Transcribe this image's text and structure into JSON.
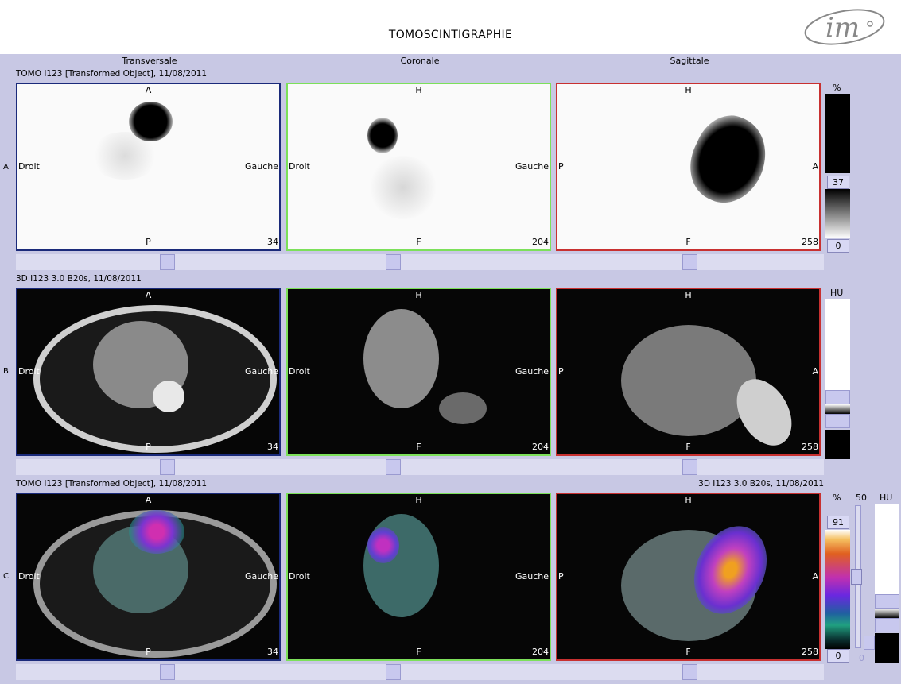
{
  "title": "TOMOSCINTIGRAPHIE",
  "logo_text": "im",
  "columns": [
    "Transversale",
    "Coronale",
    "Sagittale"
  ],
  "rows": [
    {
      "letter": "A",
      "caption": "TOMO I123 [Transformed Object], 11/08/2011"
    },
    {
      "letter": "B",
      "caption": "3D I123  3.0  B20s, 11/08/2011"
    },
    {
      "letter": "C",
      "caption": "TOMO I123 [Transformed Object], 11/08/2011",
      "caption_right": "3D I123  3.0  B20s, 11/08/2011"
    }
  ],
  "views": {
    "transversale": {
      "top": "A",
      "bottom": "P",
      "left": "Droit",
      "right": "Gauche",
      "slice": "34"
    },
    "coronale": {
      "top": "H",
      "bottom": "F",
      "left": "Droit",
      "right": "Gauche",
      "slice": "204"
    },
    "sagittale": {
      "top": "H",
      "bottom": "F",
      "left": "P",
      "right": "A",
      "slice": "258"
    }
  },
  "scales": {
    "pet_unit": "%",
    "pet_upper": "37",
    "pet_lower": "0",
    "ct_unit": "HU",
    "fusion_pet_unit": "%",
    "fusion_pet_upper": "91",
    "fusion_pet_lower": "0",
    "fusion_blend_max": "50",
    "fusion_blend_min": "0",
    "fusion_ct_unit": "HU"
  },
  "colors": {
    "transversale_border": "#1a2a7a",
    "coronale_border": "#7ce05a",
    "sagittale_border": "#c83030",
    "background": "#c8c8e4"
  }
}
